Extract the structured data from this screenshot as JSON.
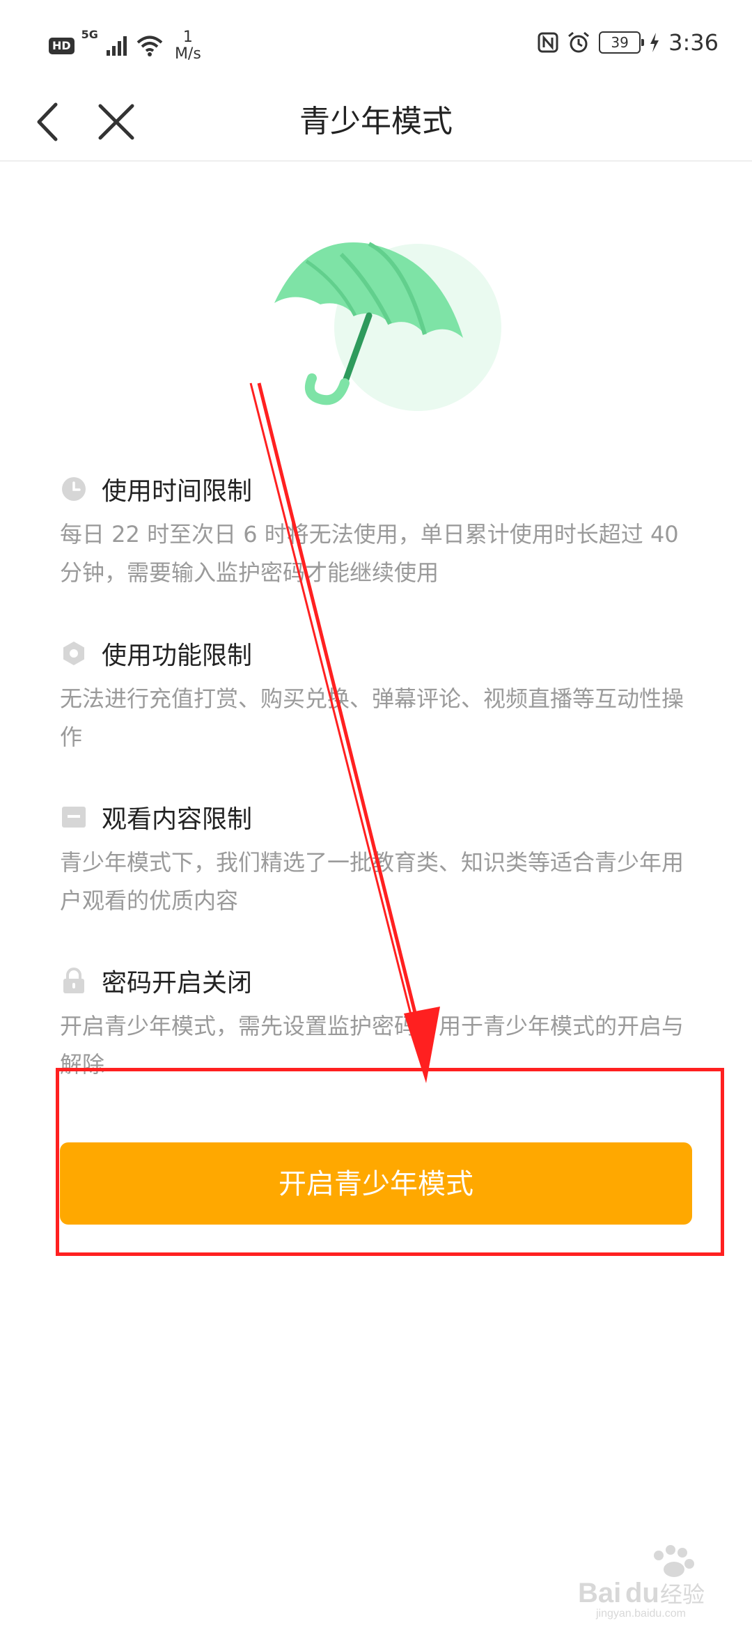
{
  "status_bar": {
    "hd": "HD",
    "network": "5G",
    "speed_value": "1",
    "speed_unit": "M/s",
    "battery": "39",
    "time": "3:36"
  },
  "nav": {
    "title": "青少年模式"
  },
  "features": [
    {
      "icon": "clock-icon",
      "title": "使用时间限制",
      "desc": "每日 22 时至次日 6 时将无法使用，单日累计使用时长超过 40分钟，需要输入监护密码才能继续使用"
    },
    {
      "icon": "hexagon-icon",
      "title": "使用功能限制",
      "desc": "无法进行充值打赏、购买兑换、弹幕评论、视频直播等互动性操作"
    },
    {
      "icon": "content-icon",
      "title": "观看内容限制",
      "desc": "青少年模式下，我们精选了一批教育类、知识类等适合青少年用户观看的优质内容"
    },
    {
      "icon": "lock-icon",
      "title": "密码开启关闭",
      "desc": "开启青少年模式，需先设置监护密码，用于青少年模式的开启与解除"
    }
  ],
  "button": {
    "label": "开启青少年模式"
  },
  "colors": {
    "accent": "#ffa800",
    "annotation": "#ff2020",
    "umbrella": "#6fdc9b"
  }
}
